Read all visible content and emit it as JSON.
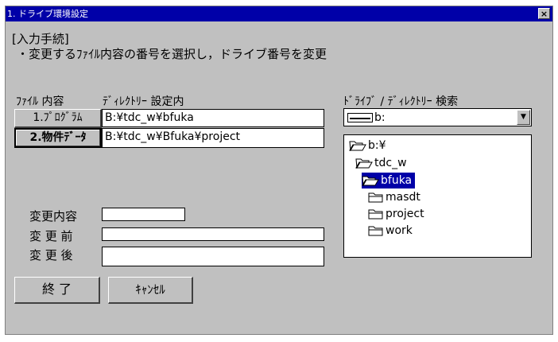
{
  "window": {
    "title": "1. ドライブ環境設定",
    "close_label": "×"
  },
  "instructions": {
    "heading": "[入力手続]",
    "line": "・変更するﾌｧｲﾙ内容の番号を選択し，ドライブ番号を変更"
  },
  "table": {
    "col_file": "ﾌｧｲﾙ 内容",
    "col_dir": "ﾃﾞｨﾚｸﾄﾘｰ 設定内",
    "rows": [
      {
        "button": "1.ﾌﾟﾛｸﾞﾗﾑ",
        "path": "B:¥tdc_w¥bfuka"
      },
      {
        "button": "2.物件ﾃﾞｰﾀ",
        "path": "B:¥tdc_w¥Bfuka¥project"
      }
    ]
  },
  "change": {
    "content_label": "変更内容",
    "before_label": "変 更 前",
    "after_label": "変 更 後",
    "content_value": "",
    "before_value": "",
    "after_value": ""
  },
  "browser": {
    "label": "ﾄﾞﾗｲﾌﾞ / ﾃﾞｨﾚｸﾄﾘｰ 検索",
    "drive_value": "b:",
    "tree": [
      {
        "label": "b:¥",
        "icon": "open-folder-icon",
        "selected": false
      },
      {
        "label": "tdc_w",
        "icon": "open-folder-icon",
        "selected": false
      },
      {
        "label": "bfuka",
        "icon": "open-folder-icon",
        "selected": true
      },
      {
        "label": "masdt",
        "icon": "folder-icon",
        "selected": false
      },
      {
        "label": "project",
        "icon": "folder-icon",
        "selected": false
      },
      {
        "label": "work",
        "icon": "folder-icon",
        "selected": false
      }
    ]
  },
  "buttons": {
    "exit": "終 了",
    "cancel": "ｷｬﾝｾﾙ"
  },
  "colors": {
    "titlebar": "#0000a8",
    "dialog": "#c0c0c0",
    "selection": "#0000a8"
  }
}
